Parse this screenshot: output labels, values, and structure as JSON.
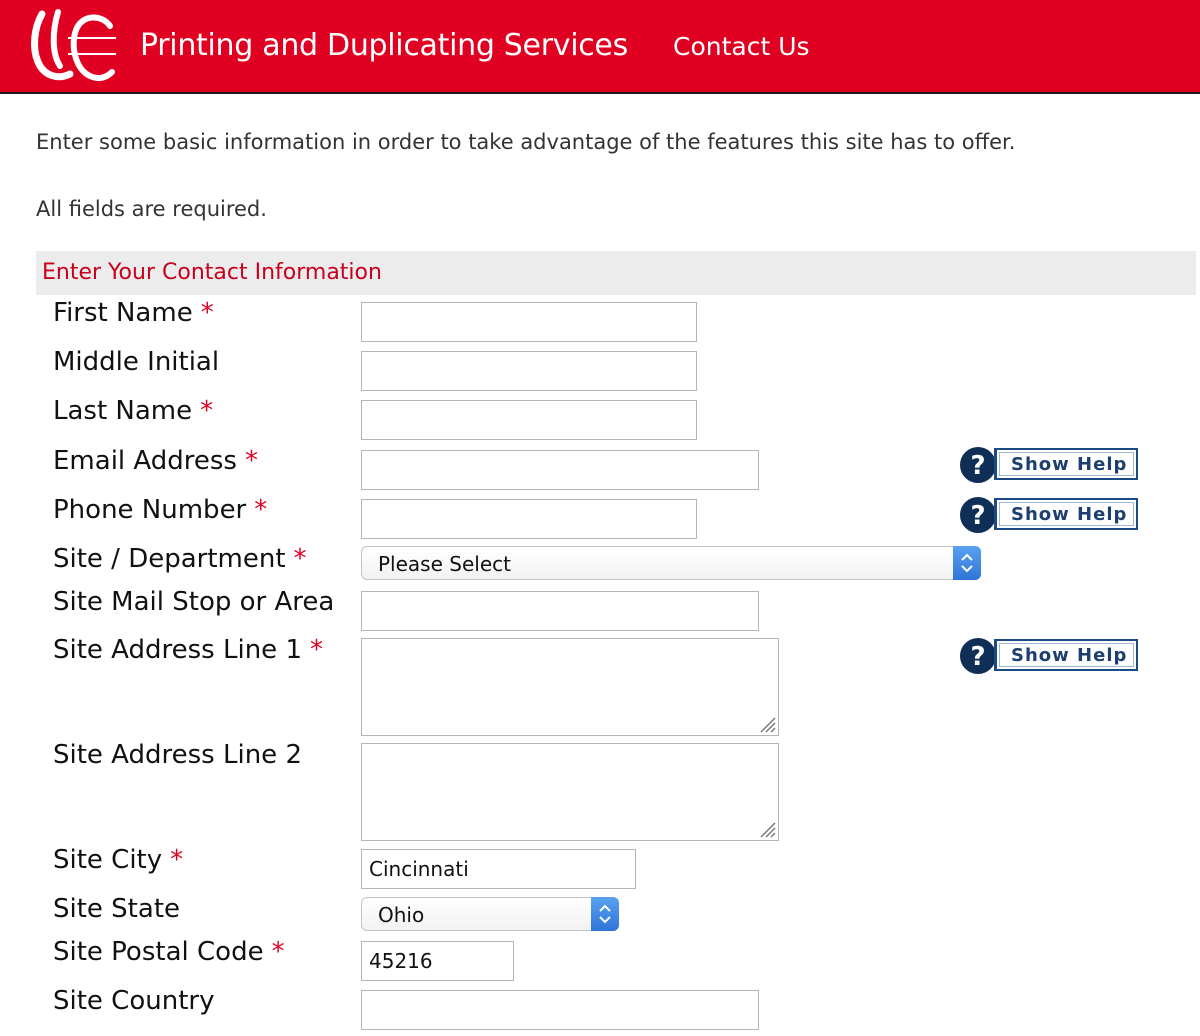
{
  "header": {
    "logo_text": "UC",
    "title": "Printing and Duplicating Services",
    "contact_link": "Contact Us"
  },
  "intro": {
    "text": "Enter some basic information in order to take advantage of the features this site has to offer.",
    "required_note": "All fields are required."
  },
  "section": {
    "title": "Enter Your Contact Information"
  },
  "colors": {
    "brand_red": "#e00122",
    "section_title": "#c8001e",
    "help_navy": "#0f2f57"
  },
  "required_marker": "*",
  "help_label": "Show Help",
  "form": {
    "first_name": {
      "label": "First Name",
      "value": ""
    },
    "middle_initial": {
      "label": "Middle Initial",
      "value": ""
    },
    "last_name": {
      "label": "Last Name",
      "value": ""
    },
    "email": {
      "label": "Email Address",
      "value": ""
    },
    "phone": {
      "label": "Phone Number",
      "value": ""
    },
    "department": {
      "label": "Site / Department",
      "selected": "Please Select"
    },
    "mail_stop": {
      "label": "Site Mail Stop or Area",
      "value": ""
    },
    "address1": {
      "label": "Site Address Line 1",
      "value": ""
    },
    "address2": {
      "label": "Site Address Line 2",
      "value": ""
    },
    "city": {
      "label": "Site City",
      "value": "Cincinnati"
    },
    "state": {
      "label": "Site State",
      "selected": "Ohio"
    },
    "postal": {
      "label": "Site Postal Code",
      "value": "45216"
    },
    "country": {
      "label": "Site Country",
      "value": ""
    }
  }
}
